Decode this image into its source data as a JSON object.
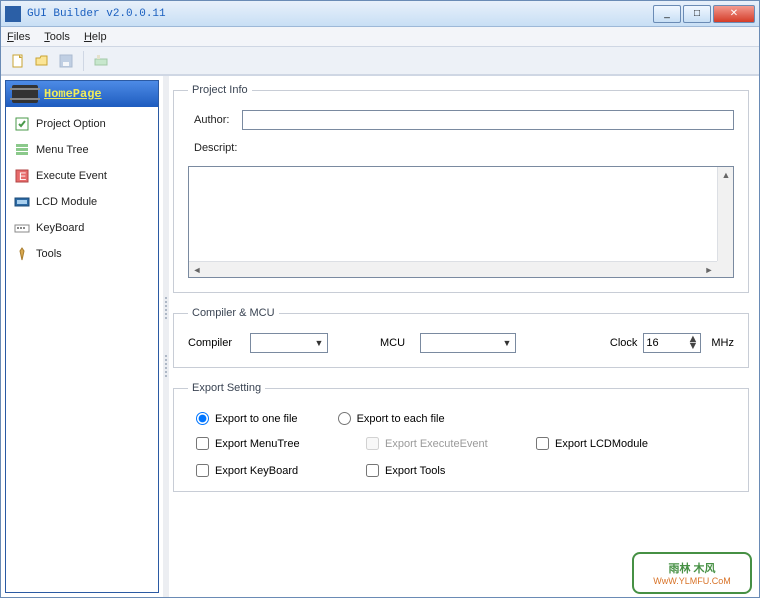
{
  "window": {
    "title": "GUI Builder v2.0.0.11"
  },
  "menu": {
    "files": "Files",
    "tools": "Tools",
    "help": "Help"
  },
  "sidebar": {
    "header": "HomePage",
    "items": [
      {
        "label": "Project Option"
      },
      {
        "label": "Menu Tree"
      },
      {
        "label": "Execute Event"
      },
      {
        "label": "LCD Module"
      },
      {
        "label": "KeyBoard"
      },
      {
        "label": "Tools"
      }
    ]
  },
  "project_info": {
    "legend": "Project Info",
    "author_label": "Author:",
    "author_value": "",
    "descript_label": "Descript:",
    "descript_value": ""
  },
  "compiler_mcu": {
    "legend": "Compiler & MCU",
    "compiler_label": "Compiler",
    "compiler_value": "",
    "mcu_label": "MCU",
    "mcu_value": "",
    "clock_label": "Clock",
    "clock_value": "16",
    "clock_unit": "MHz"
  },
  "export_setting": {
    "legend": "Export Setting",
    "radio_one": "Export to one file",
    "radio_each": "Export to each file",
    "radio_selected": "one",
    "chk_menutree": "Export MenuTree",
    "chk_execevent": "Export ExecuteEvent",
    "chk_lcdmodule": "Export LCDModule",
    "chk_keyboard": "Export KeyBoard",
    "chk_tools": "Export Tools"
  },
  "watermark": {
    "line1": "雨林 木风",
    "line2": "WwW.YLMFU.CoM"
  }
}
